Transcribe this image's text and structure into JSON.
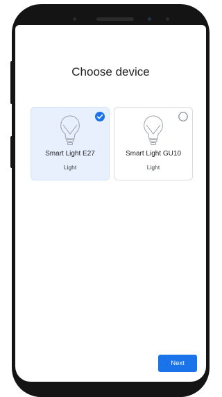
{
  "screen": {
    "title": "Choose device",
    "devices": [
      {
        "name": "Smart Light E27",
        "type": "Light",
        "selected": true,
        "icon": "light-bulb-icon"
      },
      {
        "name": "Smart Light GU10",
        "type": "Light",
        "selected": false,
        "icon": "light-bulb-icon"
      }
    ],
    "next_label": "Next"
  },
  "colors": {
    "accent": "#1a73e8",
    "selected_card_bg": "#e8f0fe",
    "phone_body": "#141414"
  }
}
